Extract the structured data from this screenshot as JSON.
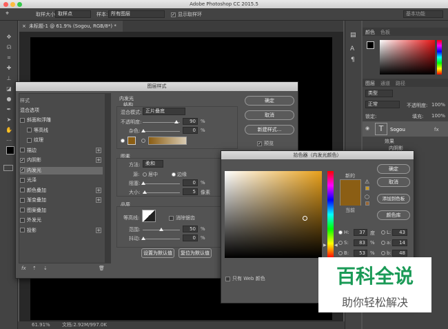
{
  "app": {
    "title": "Adobe Photoshop CC 2015.5"
  },
  "options": {
    "sample_size_label": "取样大小:",
    "sample_size_value": "取样点",
    "sample_label": "样本:",
    "sample_value": "所有图层",
    "show_ring": "显示取样环",
    "workspace": "基本功能"
  },
  "doc_tab": "未标题-1 @ 61.9% (Sogou, RGB/8*) *",
  "status": {
    "zoom": "61.91%",
    "doc": "文档:2.92M/997.0K"
  },
  "right_panel": {
    "color_tab": "颜色",
    "swatch_tab": "色板",
    "layers_tab": "图层",
    "channels_tab": "通道",
    "paths_tab": "路径",
    "kind": "类型",
    "blend": "正常",
    "opacity_label": "不透明度:",
    "opacity": "100%",
    "lock_label": "锁定:",
    "fill_label": "填充:",
    "fill": "100%",
    "layer_name": "Sogou",
    "effects": "效果",
    "inner_glow": "内阴影",
    "fx": "fx"
  },
  "layer_style": {
    "title": "图层样式",
    "styles_header": "样式",
    "blend_options": "混合选项",
    "items": [
      {
        "label": "斜面和浮雕",
        "checked": false
      },
      {
        "label": "等高线",
        "checked": false
      },
      {
        "label": "纹理",
        "checked": false
      },
      {
        "label": "描边",
        "checked": false
      },
      {
        "label": "内阴影",
        "checked": true
      },
      {
        "label": "内发光",
        "checked": true
      },
      {
        "label": "光泽",
        "checked": false
      },
      {
        "label": "颜色叠加",
        "checked": false
      },
      {
        "label": "渐变叠加",
        "checked": false
      },
      {
        "label": "图案叠加",
        "checked": false
      },
      {
        "label": "外发光",
        "checked": false
      },
      {
        "label": "投影",
        "checked": false
      }
    ],
    "section_title": "内发光",
    "structure": "结构",
    "blend_mode_label": "混合模式:",
    "blend_mode": "正片叠底",
    "opacity_label": "不透明度:",
    "opacity": "90",
    "noise_label": "杂色:",
    "noise": "0",
    "pct": "%",
    "elements": "图素",
    "method_label": "方法:",
    "method": "柔和",
    "source_label": "源:",
    "center": "居中",
    "edge": "边缘",
    "choke_label": "阻塞:",
    "choke": "0",
    "size_label": "大小:",
    "size": "5",
    "px": "像素",
    "quality": "品质",
    "contour_label": "等高线:",
    "antialias": "消除锯齿",
    "range_label": "范围:",
    "range": "50",
    "jitter_label": "抖动:",
    "jitter": "0",
    "set_default": "设置为默认值",
    "reset_default": "复位为默认值",
    "ok": "确定",
    "cancel": "取消",
    "new_style": "新建样式...",
    "preview": "预览",
    "fx": "fx"
  },
  "color_picker": {
    "title": "拾色器（内发光颜色）",
    "ok": "确定",
    "cancel": "取消",
    "add_swatch": "添加到色板",
    "libraries": "颜色库",
    "new_label": "新的",
    "current_label": "当前",
    "new_color": "#8b5e14",
    "current_color": "#8b5e14",
    "web_only": "只有 Web 颜色",
    "H_label": "H:",
    "H": "37",
    "H_unit": "度",
    "S_label": "S:",
    "S": "83",
    "S_unit": "%",
    "B_label": "B:",
    "B": "53",
    "B_unit": "%",
    "L_label": "L:",
    "L": "43",
    "a_label": "a:",
    "a": "14",
    "b_label": "b:",
    "b": "48"
  },
  "watermark": {
    "title": "百科全说",
    "subtitle": "助你轻松解决",
    "color": "#1a9a56"
  }
}
